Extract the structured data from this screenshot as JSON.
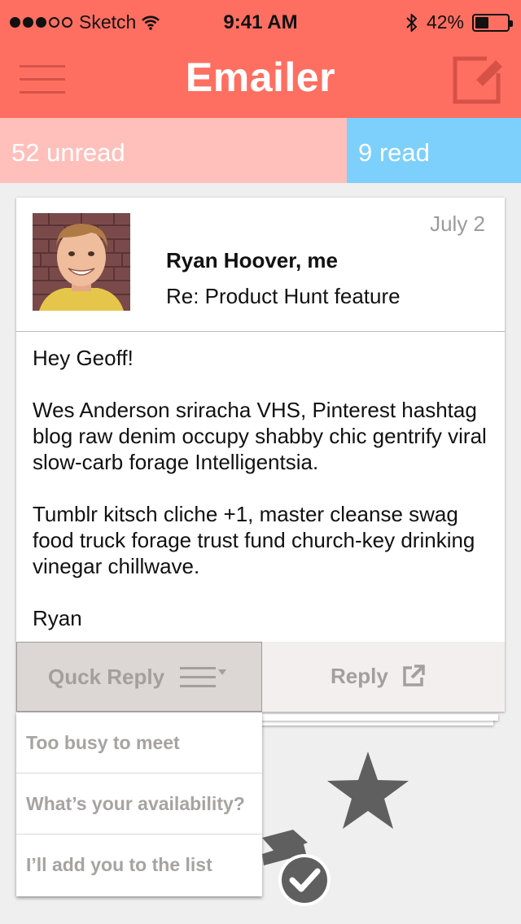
{
  "status_bar": {
    "carrier": "Sketch",
    "time": "9:41 AM",
    "battery_percent": "42%",
    "battery_level": 0.42,
    "signal_bars_filled": 3,
    "signal_bars_total": 5
  },
  "header": {
    "title": "Emailer",
    "menu_icon": "hamburger-icon",
    "compose_icon": "compose-icon",
    "background_color": "#ff6f61"
  },
  "tabs": {
    "unread": {
      "label": "52 unread",
      "color": "#ffc0bc"
    },
    "read": {
      "label": "9 read",
      "color": "#7cd0fb"
    }
  },
  "email": {
    "date": "July 2",
    "sender": "Ryan Hoover, me",
    "subject": "Re: Product Hunt feature",
    "body": [
      "Hey Geoff!",
      "Wes Anderson sriracha VHS, Pinterest hashtag blog raw denim occupy shabby chic gentrify viral slow-carb forage Intelligentsia.",
      "Tumblr kitsch cliche +1, master cleanse swag food truck forage trust fund church-key drinking vinegar chillwave.",
      "Ryan"
    ]
  },
  "actions": {
    "quick_reply_label": "Quck Reply",
    "reply_label": "Reply"
  },
  "quick_reply_options": [
    "Too busy to meet",
    "What’s your availability?",
    "I’ll add you to the list"
  ],
  "swipe_icons": [
    "star-icon",
    "archive-check-icon"
  ]
}
